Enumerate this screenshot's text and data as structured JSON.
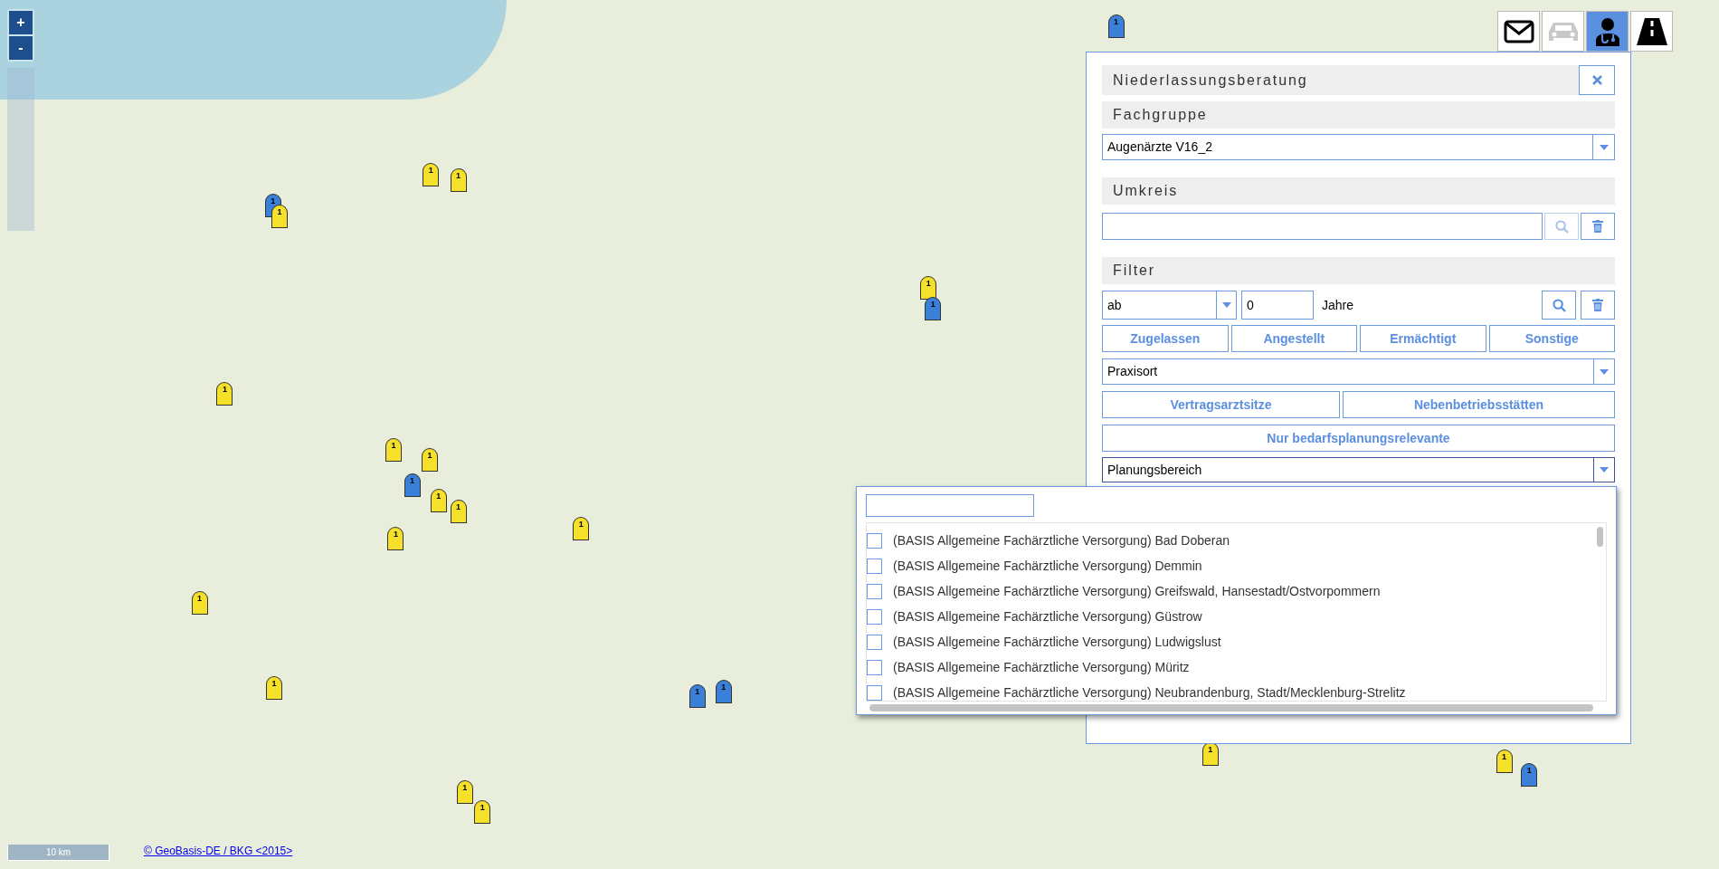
{
  "map": {
    "zoom_controls": [
      "+",
      "-"
    ],
    "scale": "10 km",
    "attribution": "© GeoBasis-DE / BKG <2015>",
    "markers": [
      {
        "color": "#f5e02a",
        "label": "1"
      },
      {
        "color": "#f5e02a",
        "label": "1"
      },
      {
        "color": "#3a7fd8",
        "label": "1"
      },
      {
        "color": "#f5e02a",
        "label": "1"
      },
      {
        "color": "#3a7fd8",
        "label": "1"
      },
      {
        "color": "#f5e02a",
        "label": "1"
      },
      {
        "color": "#3a7fd8",
        "label": "1"
      },
      {
        "color": "#f5e02a",
        "label": "1"
      },
      {
        "color": "#f5e02a",
        "label": "1"
      },
      {
        "color": "#3a7fd8",
        "label": "1"
      },
      {
        "color": "#f5e02a",
        "label": "1"
      },
      {
        "color": "#f5e02a",
        "label": "1"
      },
      {
        "color": "#f5e02a",
        "label": "1"
      },
      {
        "color": "#f5e02a",
        "label": "1"
      },
      {
        "color": "#f5e02a",
        "label": "1"
      },
      {
        "color": "#f5e02a",
        "label": "1"
      },
      {
        "color": "#f5e02a",
        "label": "1"
      },
      {
        "color": "#3a7fd8",
        "label": "1"
      },
      {
        "color": "#3a7fd8",
        "label": "1"
      },
      {
        "color": "#f5e02a",
        "label": "1"
      },
      {
        "color": "#f5e02a",
        "label": "1"
      },
      {
        "color": "#f5e02a",
        "label": "1"
      },
      {
        "color": "#3a7fd8",
        "label": "1"
      },
      {
        "color": "#f5e02a",
        "label": "1"
      }
    ]
  },
  "toolbar": [
    {
      "kind": "mail",
      "selected": false,
      "disabled": false
    },
    {
      "kind": "car",
      "selected": false,
      "disabled": true
    },
    {
      "kind": "doctor",
      "selected": true,
      "disabled": false
    },
    {
      "kind": "road",
      "selected": false,
      "disabled": false
    }
  ],
  "panel": {
    "title": "Niederlassungsberatung",
    "fachgruppe": {
      "heading": "Fachgruppe",
      "value": "Augenärzte V16_2"
    },
    "umkreis": {
      "heading": "Umkreis"
    },
    "filter": {
      "heading": "Filter",
      "operator": "ab",
      "years": "0",
      "unit": "Jahre",
      "status_buttons": [
        "Zugelassen",
        "Angestellt",
        "Ermächtigt",
        "Sonstige"
      ],
      "location": "Praxisort",
      "type_buttons": [
        "Vertragsarztsitze",
        "Nebenbetriebsstätten"
      ],
      "relevance_button": "Nur bedarfsplanungsrelevante",
      "area": "Planungsbereich"
    }
  },
  "area_dropdown": {
    "options": [
      {
        "label": "(BASIS Allgemeine Fachärztliche Versorgung) Bad Doberan",
        "checked": false
      },
      {
        "label": "(BASIS Allgemeine Fachärztliche Versorgung) Demmin",
        "checked": false
      },
      {
        "label": "(BASIS Allgemeine Fachärztliche Versorgung) Greifswald, Hansestadt/Ostvorpommern",
        "checked": false
      },
      {
        "label": "(BASIS Allgemeine Fachärztliche Versorgung) Güstrow",
        "checked": false
      },
      {
        "label": "(BASIS Allgemeine Fachärztliche Versorgung) Ludwigslust",
        "checked": false
      },
      {
        "label": "(BASIS Allgemeine Fachärztliche Versorgung) Müritz",
        "checked": false
      },
      {
        "label": "(BASIS Allgemeine Fachärztliche Versorgung) Neubrandenburg, Stadt/Mecklenburg-Strelitz",
        "checked": false
      }
    ]
  }
}
